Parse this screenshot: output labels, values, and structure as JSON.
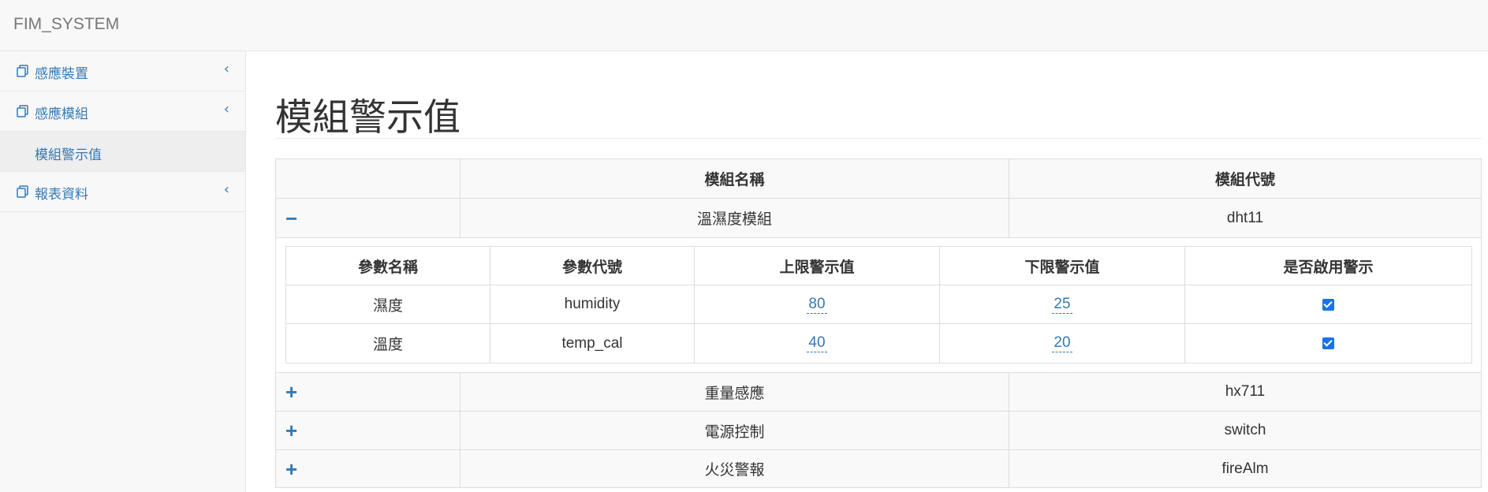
{
  "app": {
    "brand": "FIM_SYSTEM"
  },
  "sidebar": {
    "items": [
      {
        "label": "感應裝置",
        "icon": "copy-icon",
        "chevron": "‹"
      },
      {
        "label": "感應模組",
        "icon": "copy-icon",
        "chevron": "‹",
        "sub": [
          {
            "label": "模組警示值"
          }
        ]
      },
      {
        "label": "報表資料",
        "icon": "copy-icon",
        "chevron": "‹"
      }
    ]
  },
  "page": {
    "title": "模組警示值"
  },
  "table": {
    "headers": [
      "",
      "模組名稱",
      "模組代號"
    ],
    "rows": [
      {
        "toggle": "−",
        "name": "溫濕度模組",
        "code": "dht11"
      },
      {
        "toggle": "+",
        "name": "重量感應",
        "code": "hx711"
      },
      {
        "toggle": "+",
        "name": "電源控制",
        "code": "switch"
      },
      {
        "toggle": "+",
        "name": "火災警報",
        "code": "fireAlm"
      }
    ],
    "detail": {
      "headers": [
        "參數名稱",
        "參數代號",
        "上限警示值",
        "下限警示值",
        "是否啟用警示"
      ],
      "rows": [
        {
          "name": "濕度",
          "code": "humidity",
          "upper": "80",
          "lower": "25",
          "enabled": true
        },
        {
          "name": "溫度",
          "code": "temp_cal",
          "upper": "40",
          "lower": "20",
          "enabled": true
        }
      ]
    }
  },
  "colors": {
    "accent": "#337ab7",
    "checkbox": "#1a73e8"
  }
}
